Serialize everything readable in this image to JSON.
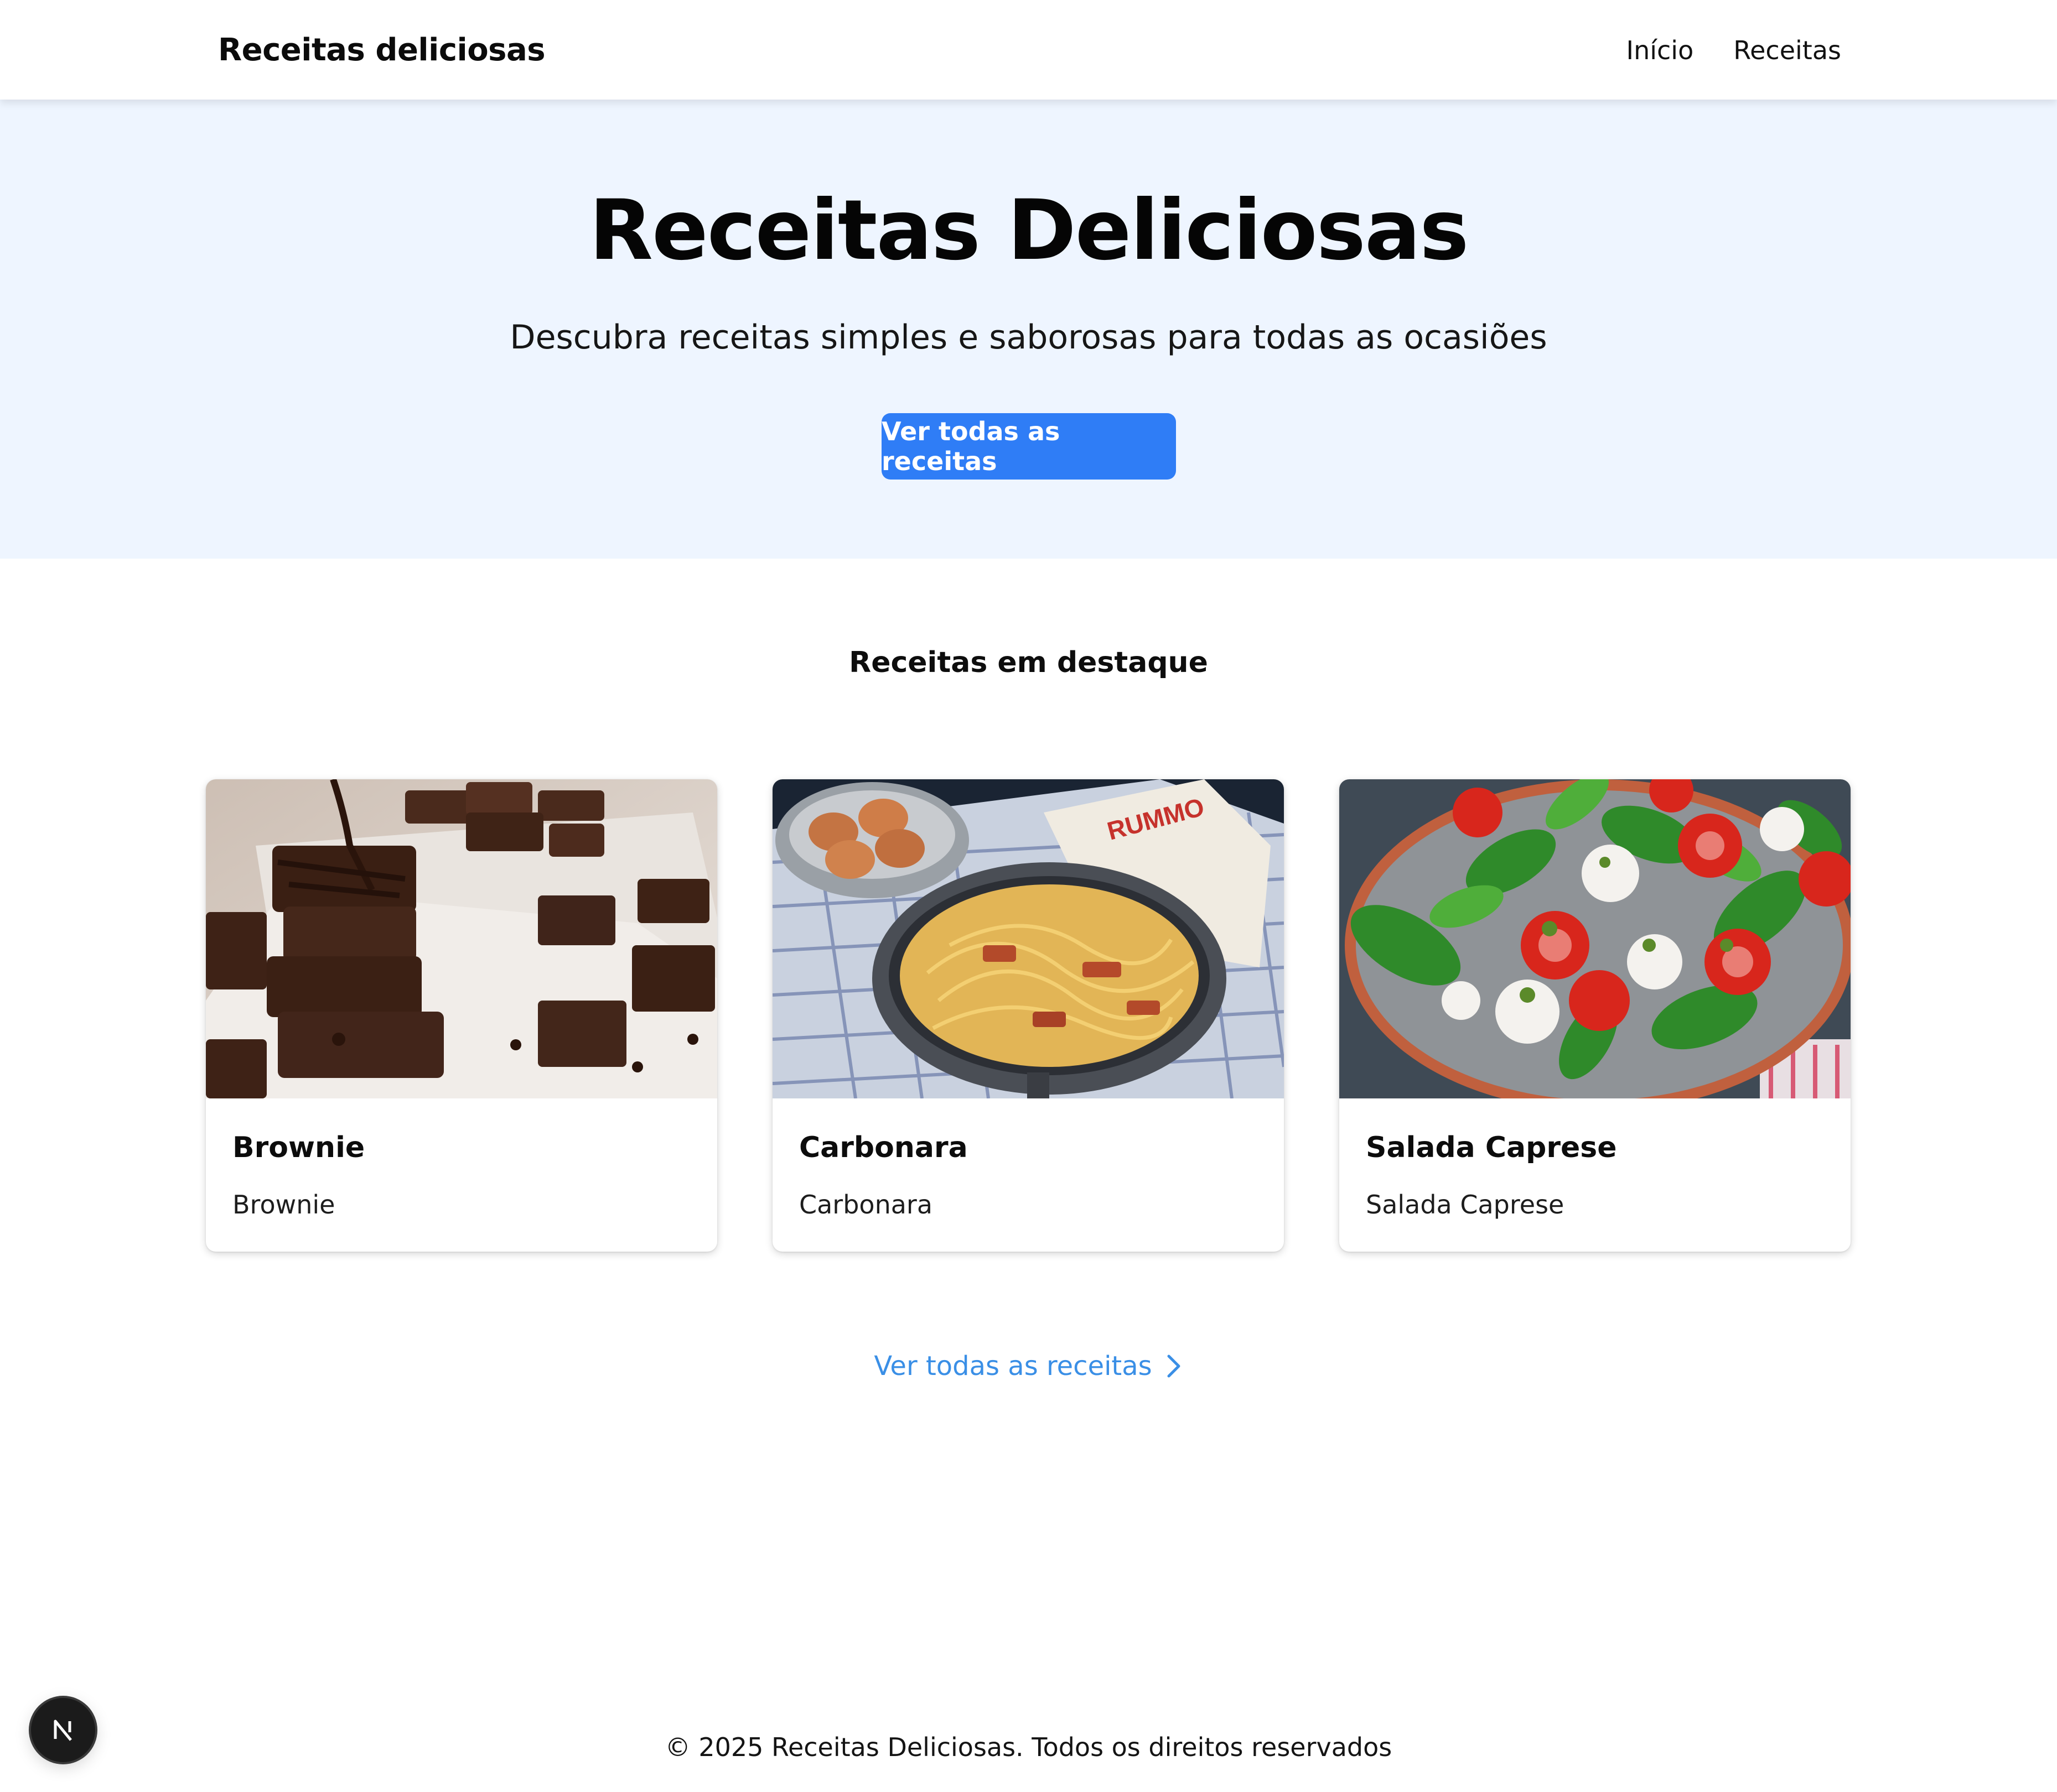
{
  "navbar": {
    "brand": "Receitas deliciosas",
    "links": [
      "Início",
      "Receitas"
    ]
  },
  "hero": {
    "title": "Receitas Deliciosas",
    "subtitle": "Descubra receitas simples e saborosas para todas as ocasiões",
    "button_label": "Ver todas as receitas"
  },
  "featured": {
    "title": "Receitas em destaque",
    "cards": [
      {
        "title": "Brownie",
        "description": "Brownie",
        "image": "brownie-photo"
      },
      {
        "title": "Carbonara",
        "description": "Carbonara",
        "image": "carbonara-photo"
      },
      {
        "title": "Salada Caprese",
        "description": "Salada Caprese",
        "image": "caprese-salad-photo"
      }
    ],
    "see_all_label": "Ver todas as receitas",
    "see_all_icon": "chevron-right-icon"
  },
  "footer": {
    "text": "© 2025 Receitas Deliciosas. Todos os direitos reservados"
  },
  "dev_badge": {
    "letter": "N",
    "icon": "nextjs-logo-icon"
  },
  "colors": {
    "hero_background": "#eef5ff",
    "primary_button": "#2f7df6",
    "link": "#3a8fe6"
  }
}
